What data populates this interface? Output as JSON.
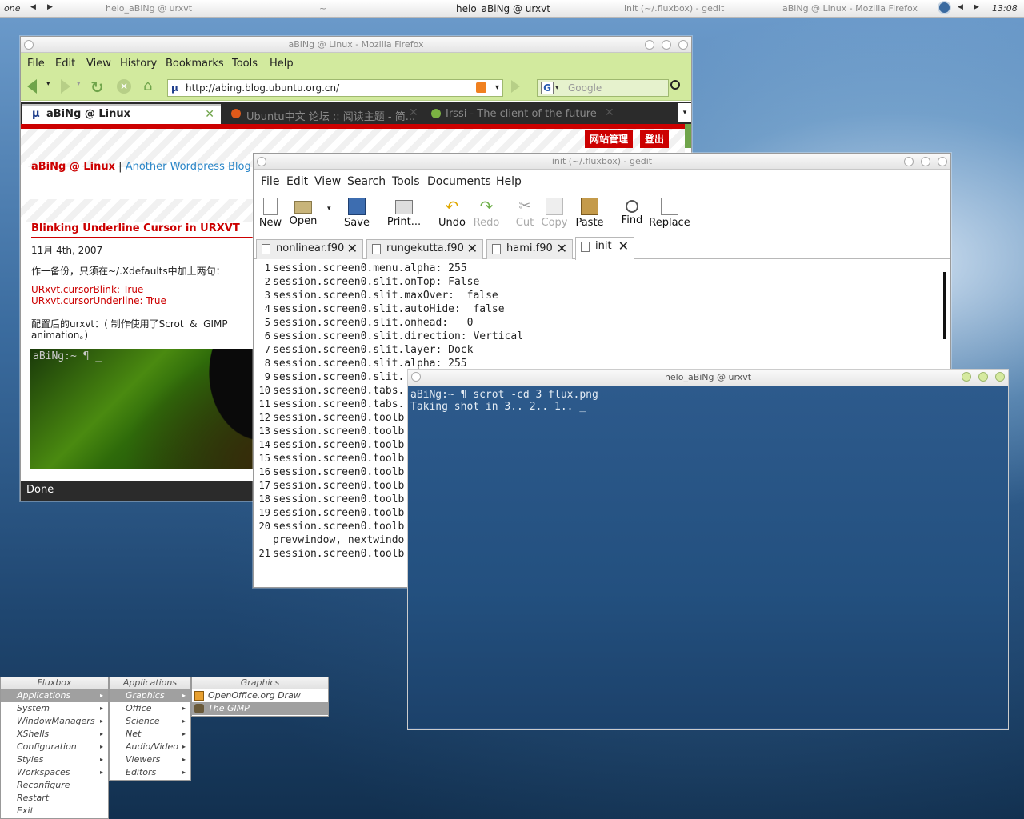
{
  "toolbar": {
    "workspace": "one",
    "tasks": [
      "helo_aBiNg @ urxvt",
      "~",
      "helo_aBiNg @ urxvt",
      "init (~/.fluxbox) - gedit",
      "aBiNg @ Linux - Mozilla Firefox"
    ],
    "clock": "13:08"
  },
  "firefox": {
    "title": "aBiNg @ Linux - Mozilla Firefox",
    "menu": [
      "File",
      "Edit",
      "View",
      "History",
      "Bookmarks",
      "Tools",
      "Help"
    ],
    "url": "http://abing.blog.ubuntu.org.cn/",
    "search_placeholder": "Google",
    "tabs": [
      "aBiNg @ Linux",
      "Ubuntu中文 论坛 :: 阅读主题 - 简...",
      "Irssi - The client of the future"
    ],
    "page": {
      "admin_btn": "网站管理",
      "logout_btn": "登出",
      "blog_title": "aBiNg @ Linux",
      "sep": "|",
      "blog_tagline": "Another Wordpress Blog",
      "post_title": "Blinking Underline Cursor in URXVT",
      "post_date": "11月 4th, 2007",
      "para1": "作一备份，只须在~/.Xdefaults中加上两句：",
      "code1": "URxvt.cursorBlink: True",
      "code2": "URxvt.cursorUnderline: True",
      "para2a": "配置后的urxvt：( 制作使用了Scrot  &  GIMP",
      "para2b": "animation。)",
      "term_prompt": "aBiNg:~ ¶ _"
    },
    "status": "Done"
  },
  "gedit": {
    "title": "init (~/.fluxbox) - gedit",
    "menu": [
      "File",
      "Edit",
      "View",
      "Search",
      "Tools",
      "Documents",
      "Help"
    ],
    "buttons": [
      "New",
      "Open",
      "Save",
      "Print...",
      "Undo",
      "Redo",
      "Cut",
      "Copy",
      "Paste",
      "Find",
      "Replace"
    ],
    "tabs": [
      "nonlinear.f90",
      "rungekutta.f90",
      "hami.f90",
      "init"
    ],
    "lines": [
      {
        "n": "1",
        "t": "session.screen0.menu.alpha: 255"
      },
      {
        "n": "2",
        "t": "session.screen0.slit.onTop: False"
      },
      {
        "n": "3",
        "t": "session.screen0.slit.maxOver:  false"
      },
      {
        "n": "4",
        "t": "session.screen0.slit.autoHide:  false"
      },
      {
        "n": "5",
        "t": "session.screen0.slit.onhead:   0"
      },
      {
        "n": "6",
        "t": "session.screen0.slit.direction: Vertical"
      },
      {
        "n": "7",
        "t": "session.screen0.slit.layer: Dock"
      },
      {
        "n": "8",
        "t": "session.screen0.slit.alpha: 255"
      },
      {
        "n": "9",
        "t": "session.screen0.slit."
      },
      {
        "n": "10",
        "t": "session.screen0.tabs."
      },
      {
        "n": "11",
        "t": "session.screen0.tabs."
      },
      {
        "n": "12",
        "t": "session.screen0.toolb"
      },
      {
        "n": "13",
        "t": "session.screen0.toolb"
      },
      {
        "n": "14",
        "t": "session.screen0.toolb"
      },
      {
        "n": "15",
        "t": "session.screen0.toolb"
      },
      {
        "n": "16",
        "t": "session.screen0.toolb"
      },
      {
        "n": "17",
        "t": "session.screen0.toolb"
      },
      {
        "n": "18",
        "t": "session.screen0.toolb"
      },
      {
        "n": "19",
        "t": "session.screen0.toolb"
      },
      {
        "n": "20",
        "t": "session.screen0.toolb"
      },
      {
        "n": "",
        "t": "prevwindow, nextwindo"
      },
      {
        "n": "21",
        "t": "session.screen0.toolb"
      }
    ]
  },
  "urxvt": {
    "title": "helo_aBiNg @ urxvt",
    "line1": "aBiNg:~ ¶ scrot -cd 3 flux.png",
    "line2": "Taking shot in 3.. 2.. 1.. _"
  },
  "menus": {
    "root": {
      "title": "Fluxbox",
      "items": [
        "Applications",
        "System",
        "WindowManagers",
        "XShells",
        "Configuration",
        "Styles",
        "Workspaces",
        "Reconfigure",
        "Restart",
        "Exit"
      ]
    },
    "apps": {
      "title": "Applications",
      "items": [
        "Graphics",
        "Office",
        "Science",
        "Net",
        "Audio/Video",
        "Viewers",
        "Editors"
      ]
    },
    "graphics": {
      "title": "Graphics",
      "items": [
        "OpenOffice.org Draw",
        "The GIMP"
      ]
    }
  }
}
